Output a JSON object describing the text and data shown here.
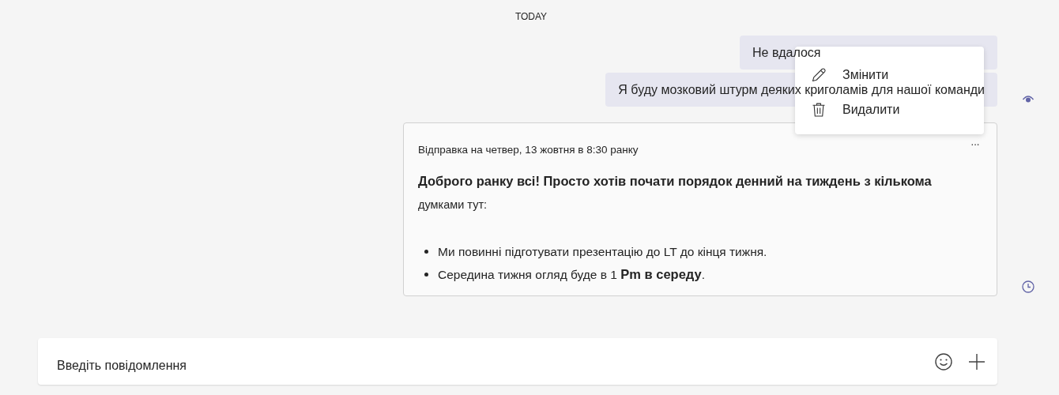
{
  "date_divider": "TODAY",
  "messages": [
    {
      "kind": "text",
      "text": "Не вдалося",
      "read": false
    },
    {
      "kind": "text",
      "text": "Я буду мозковий штурм деяких криголамів для нашої команди",
      "read": true
    },
    {
      "kind": "scheduled",
      "header": "Відправка на четвер, 13 жовтня в 8:30 ранку",
      "more": "···",
      "paragraph": "**Доброго ранку всі! Просто хотів почати порядок денний на тиждень з кількома** думками тут:",
      "bullets": [
        "Ми повинні підготувати презентацію до LT до кінця тижня.",
        "Середина тижня огляд буде в 1  **Pm в середу**."
      ]
    }
  ],
  "context_menu": {
    "items": [
      {
        "kind": "edit",
        "label": "Змінити"
      },
      {
        "kind": "delete",
        "label": "Видалити"
      }
    ]
  },
  "compose": {
    "placeholder": "Введіть повідомлення"
  }
}
